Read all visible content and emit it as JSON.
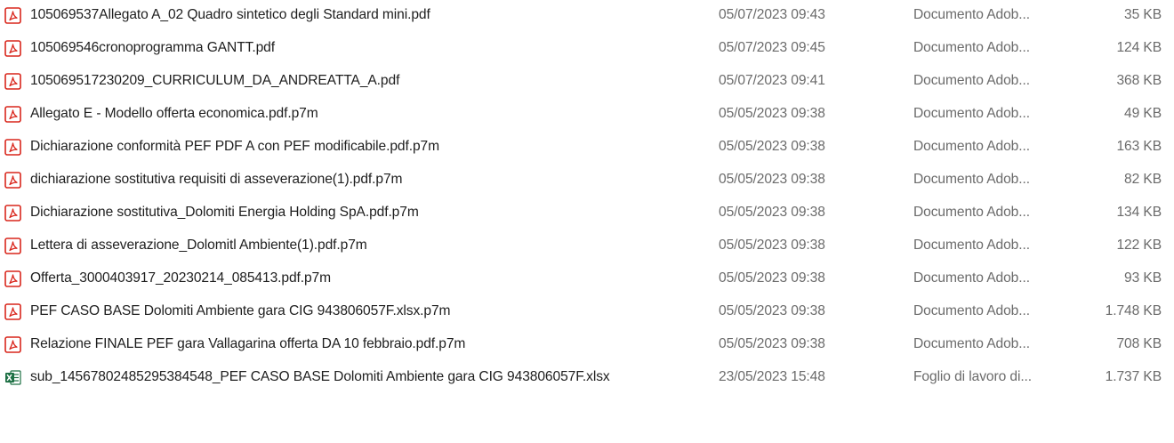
{
  "files": [
    {
      "name": "105069537Allegato A_02 Quadro sintetico degli Standard mini.pdf",
      "modified": "05/07/2023 09:43",
      "type": "Documento Adob...",
      "size": "35 KB",
      "icon": "pdf-icon"
    },
    {
      "name": "105069546cronoprogramma GANTT.pdf",
      "modified": "05/07/2023 09:45",
      "type": "Documento Adob...",
      "size": "124 KB",
      "icon": "pdf-icon"
    },
    {
      "name": "105069517230209_CURRICULUM_DA_ANDREATTA_A.pdf",
      "modified": "05/07/2023 09:41",
      "type": "Documento Adob...",
      "size": "368 KB",
      "icon": "pdf-icon"
    },
    {
      "name": "Allegato E - Modello offerta economica.pdf.p7m",
      "modified": "05/05/2023 09:38",
      "type": "Documento Adob...",
      "size": "49 KB",
      "icon": "pdf-icon"
    },
    {
      "name": "Dichiarazione conformità PEF PDF A con PEF modificabile.pdf.p7m",
      "modified": "05/05/2023 09:38",
      "type": "Documento Adob...",
      "size": "163 KB",
      "icon": "pdf-icon"
    },
    {
      "name": "dichiarazione sostitutiva requisiti di asseverazione(1).pdf.p7m",
      "modified": "05/05/2023 09:38",
      "type": "Documento Adob...",
      "size": "82 KB",
      "icon": "pdf-icon"
    },
    {
      "name": "Dichiarazione sostitutiva_Dolomiti Energia Holding SpA.pdf.p7m",
      "modified": "05/05/2023 09:38",
      "type": "Documento Adob...",
      "size": "134 KB",
      "icon": "pdf-icon"
    },
    {
      "name": "Lettera di asseverazione_Dolomitl Ambiente(1).pdf.p7m",
      "modified": "05/05/2023 09:38",
      "type": "Documento Adob...",
      "size": "122 KB",
      "icon": "pdf-icon"
    },
    {
      "name": "Offerta_3000403917_20230214_085413.pdf.p7m",
      "modified": "05/05/2023 09:38",
      "type": "Documento Adob...",
      "size": "93 KB",
      "icon": "pdf-icon"
    },
    {
      "name": "PEF CASO BASE Dolomiti Ambiente  gara CIG 943806057F.xlsx.p7m",
      "modified": "05/05/2023 09:38",
      "type": "Documento Adob...",
      "size": "1.748 KB",
      "icon": "pdf-icon"
    },
    {
      "name": "Relazione FINALE PEF gara Vallagarina offerta DA 10 febbraio.pdf.p7m",
      "modified": "05/05/2023 09:38",
      "type": "Documento Adob...",
      "size": "708 KB",
      "icon": "pdf-icon"
    },
    {
      "name": "sub_14567802485295384548_PEF CASO BASE Dolomiti Ambiente  gara CIG 943806057F.xlsx",
      "modified": "23/05/2023 15:48",
      "type": "Foglio di lavoro di...",
      "size": "1.737 KB",
      "icon": "excel-icon"
    }
  ],
  "colors": {
    "pdf_icon": "#d9261c",
    "excel_icon": "#1d7044",
    "secondary_text": "#6b6b6b",
    "primary_text": "#1e1e1e"
  }
}
